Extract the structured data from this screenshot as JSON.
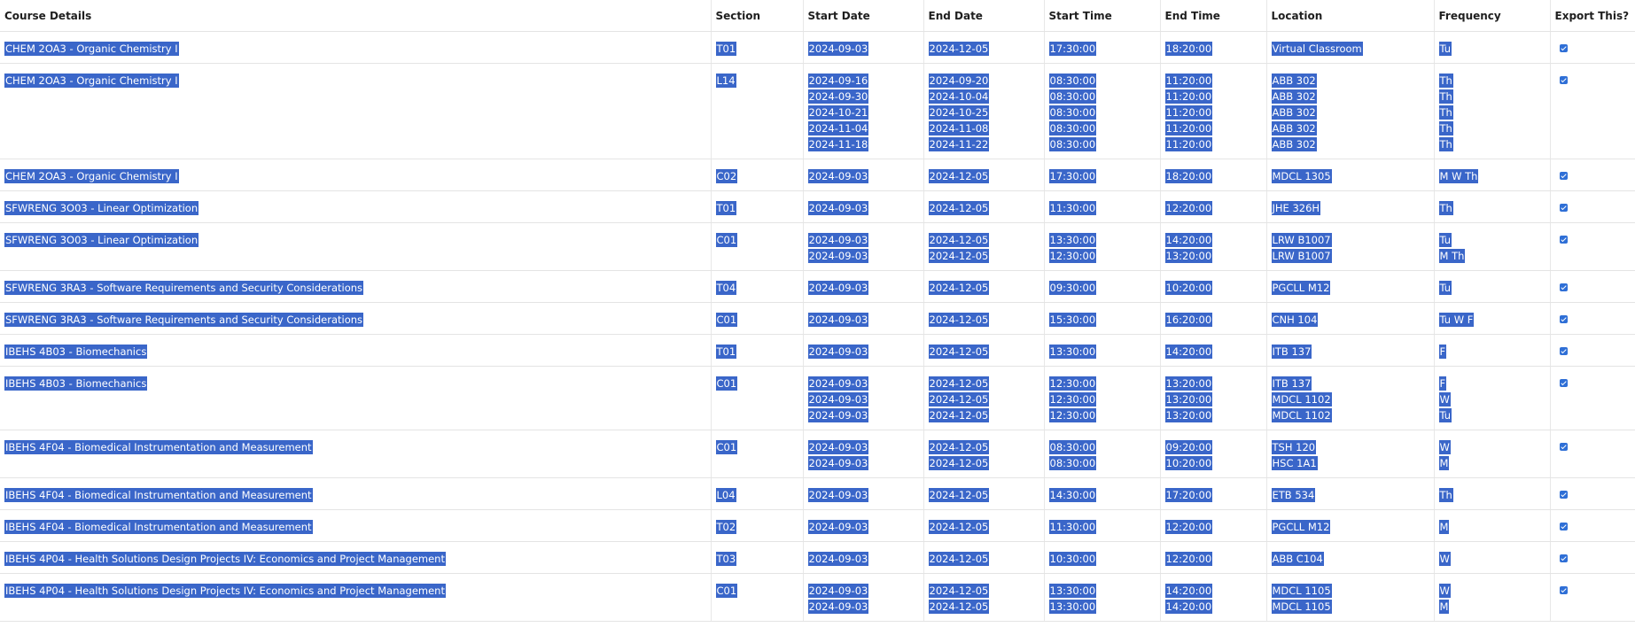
{
  "headers": [
    "Course Details",
    "Section",
    "Start Date",
    "End Date",
    "Start Time",
    "End Time",
    "Location",
    "Frequency",
    "Export This?"
  ],
  "rows": [
    {
      "course": "CHEM 2OA3 - Organic Chemistry I",
      "section": "T01",
      "start_dates": [
        "2024-09-03"
      ],
      "end_dates": [
        "2024-12-05"
      ],
      "start_times": [
        "17:30:00"
      ],
      "end_times": [
        "18:20:00"
      ],
      "locations": [
        "Virtual Classroom"
      ],
      "frequencies": [
        "Tu"
      ],
      "export": true
    },
    {
      "course": "CHEM 2OA3 - Organic Chemistry I",
      "section": "L14",
      "start_dates": [
        "2024-09-16",
        "2024-09-30",
        "2024-10-21",
        "2024-11-04",
        "2024-11-18"
      ],
      "end_dates": [
        "2024-09-20",
        "2024-10-04",
        "2024-10-25",
        "2024-11-08",
        "2024-11-22"
      ],
      "start_times": [
        "08:30:00",
        "08:30:00",
        "08:30:00",
        "08:30:00",
        "08:30:00"
      ],
      "end_times": [
        "11:20:00",
        "11:20:00",
        "11:20:00",
        "11:20:00",
        "11:20:00"
      ],
      "locations": [
        "ABB 302",
        "ABB 302",
        "ABB 302",
        "ABB 302",
        "ABB 302"
      ],
      "frequencies": [
        "Th",
        "Th",
        "Th",
        "Th",
        "Th"
      ],
      "export": true
    },
    {
      "course": "CHEM 2OA3 - Organic Chemistry I",
      "section": "C02",
      "start_dates": [
        "2024-09-03"
      ],
      "end_dates": [
        "2024-12-05"
      ],
      "start_times": [
        "17:30:00"
      ],
      "end_times": [
        "18:20:00"
      ],
      "locations": [
        "MDCL 1305"
      ],
      "frequencies": [
        "M W Th"
      ],
      "export": true
    },
    {
      "course": "SFWRENG 3O03 - Linear Optimization",
      "section": "T01",
      "start_dates": [
        "2024-09-03"
      ],
      "end_dates": [
        "2024-12-05"
      ],
      "start_times": [
        "11:30:00"
      ],
      "end_times": [
        "12:20:00"
      ],
      "locations": [
        "JHE 326H"
      ],
      "frequencies": [
        "Th"
      ],
      "export": true
    },
    {
      "course": "SFWRENG 3O03 - Linear Optimization",
      "section": "C01",
      "start_dates": [
        "2024-09-03",
        "2024-09-03"
      ],
      "end_dates": [
        "2024-12-05",
        "2024-12-05"
      ],
      "start_times": [
        "13:30:00",
        "12:30:00"
      ],
      "end_times": [
        "14:20:00",
        "13:20:00"
      ],
      "locations": [
        "LRW B1007",
        "LRW B1007"
      ],
      "frequencies": [
        "Tu",
        "M Th"
      ],
      "export": true
    },
    {
      "course": "SFWRENG 3RA3 - Software Requirements and Security Considerations",
      "section": "T04",
      "start_dates": [
        "2024-09-03"
      ],
      "end_dates": [
        "2024-12-05"
      ],
      "start_times": [
        "09:30:00"
      ],
      "end_times": [
        "10:20:00"
      ],
      "locations": [
        "PGCLL M12"
      ],
      "frequencies": [
        "Tu"
      ],
      "export": true
    },
    {
      "course": "SFWRENG 3RA3 - Software Requirements and Security Considerations",
      "section": "C01",
      "start_dates": [
        "2024-09-03"
      ],
      "end_dates": [
        "2024-12-05"
      ],
      "start_times": [
        "15:30:00"
      ],
      "end_times": [
        "16:20:00"
      ],
      "locations": [
        "CNH 104"
      ],
      "frequencies": [
        "Tu W F"
      ],
      "export": true
    },
    {
      "course": "IBEHS 4B03 - Biomechanics",
      "section": "T01",
      "start_dates": [
        "2024-09-03"
      ],
      "end_dates": [
        "2024-12-05"
      ],
      "start_times": [
        "13:30:00"
      ],
      "end_times": [
        "14:20:00"
      ],
      "locations": [
        "ITB 137"
      ],
      "frequencies": [
        "F"
      ],
      "export": true
    },
    {
      "course": "IBEHS 4B03 - Biomechanics",
      "section": "C01",
      "start_dates": [
        "2024-09-03",
        "2024-09-03",
        "2024-09-03"
      ],
      "end_dates": [
        "2024-12-05",
        "2024-12-05",
        "2024-12-05"
      ],
      "start_times": [
        "12:30:00",
        "12:30:00",
        "12:30:00"
      ],
      "end_times": [
        "13:20:00",
        "13:20:00",
        "13:20:00"
      ],
      "locations": [
        "ITB 137",
        "MDCL 1102",
        "MDCL 1102"
      ],
      "frequencies": [
        "F",
        "W",
        "Tu"
      ],
      "export": true
    },
    {
      "course": "IBEHS 4F04 - Biomedical Instrumentation and Measurement",
      "section": "C01",
      "start_dates": [
        "2024-09-03",
        "2024-09-03"
      ],
      "end_dates": [
        "2024-12-05",
        "2024-12-05"
      ],
      "start_times": [
        "08:30:00",
        "08:30:00"
      ],
      "end_times": [
        "09:20:00",
        "10:20:00"
      ],
      "locations": [
        "TSH 120",
        "HSC 1A1"
      ],
      "frequencies": [
        "W",
        "M"
      ],
      "export": true
    },
    {
      "course": "IBEHS 4F04 - Biomedical Instrumentation and Measurement",
      "section": "L04",
      "start_dates": [
        "2024-09-03"
      ],
      "end_dates": [
        "2024-12-05"
      ],
      "start_times": [
        "14:30:00"
      ],
      "end_times": [
        "17:20:00"
      ],
      "locations": [
        "ETB 534"
      ],
      "frequencies": [
        "Th"
      ],
      "export": true
    },
    {
      "course": "IBEHS 4F04 - Biomedical Instrumentation and Measurement",
      "section": "T02",
      "start_dates": [
        "2024-09-03"
      ],
      "end_dates": [
        "2024-12-05"
      ],
      "start_times": [
        "11:30:00"
      ],
      "end_times": [
        "12:20:00"
      ],
      "locations": [
        "PGCLL M12"
      ],
      "frequencies": [
        "M"
      ],
      "export": true
    },
    {
      "course": "IBEHS 4P04 - Health Solutions Design Projects IV: Economics and Project Management",
      "section": "T03",
      "start_dates": [
        "2024-09-03"
      ],
      "end_dates": [
        "2024-12-05"
      ],
      "start_times": [
        "10:30:00"
      ],
      "end_times": [
        "12:20:00"
      ],
      "locations": [
        "ABB C104"
      ],
      "frequencies": [
        "W"
      ],
      "export": true
    },
    {
      "course": "IBEHS 4P04 - Health Solutions Design Projects IV: Economics and Project Management",
      "section": "C01",
      "start_dates": [
        "2024-09-03",
        "2024-09-03"
      ],
      "end_dates": [
        "2024-12-05",
        "2024-12-05"
      ],
      "start_times": [
        "13:30:00",
        "13:30:00"
      ],
      "end_times": [
        "14:20:00",
        "14:20:00"
      ],
      "locations": [
        "MDCL 1105",
        "MDCL 1105"
      ],
      "frequencies": [
        "W",
        "M"
      ],
      "export": true
    }
  ],
  "colors": {
    "selection": "#3a66c9",
    "checkbox": "#2f6fd6"
  }
}
